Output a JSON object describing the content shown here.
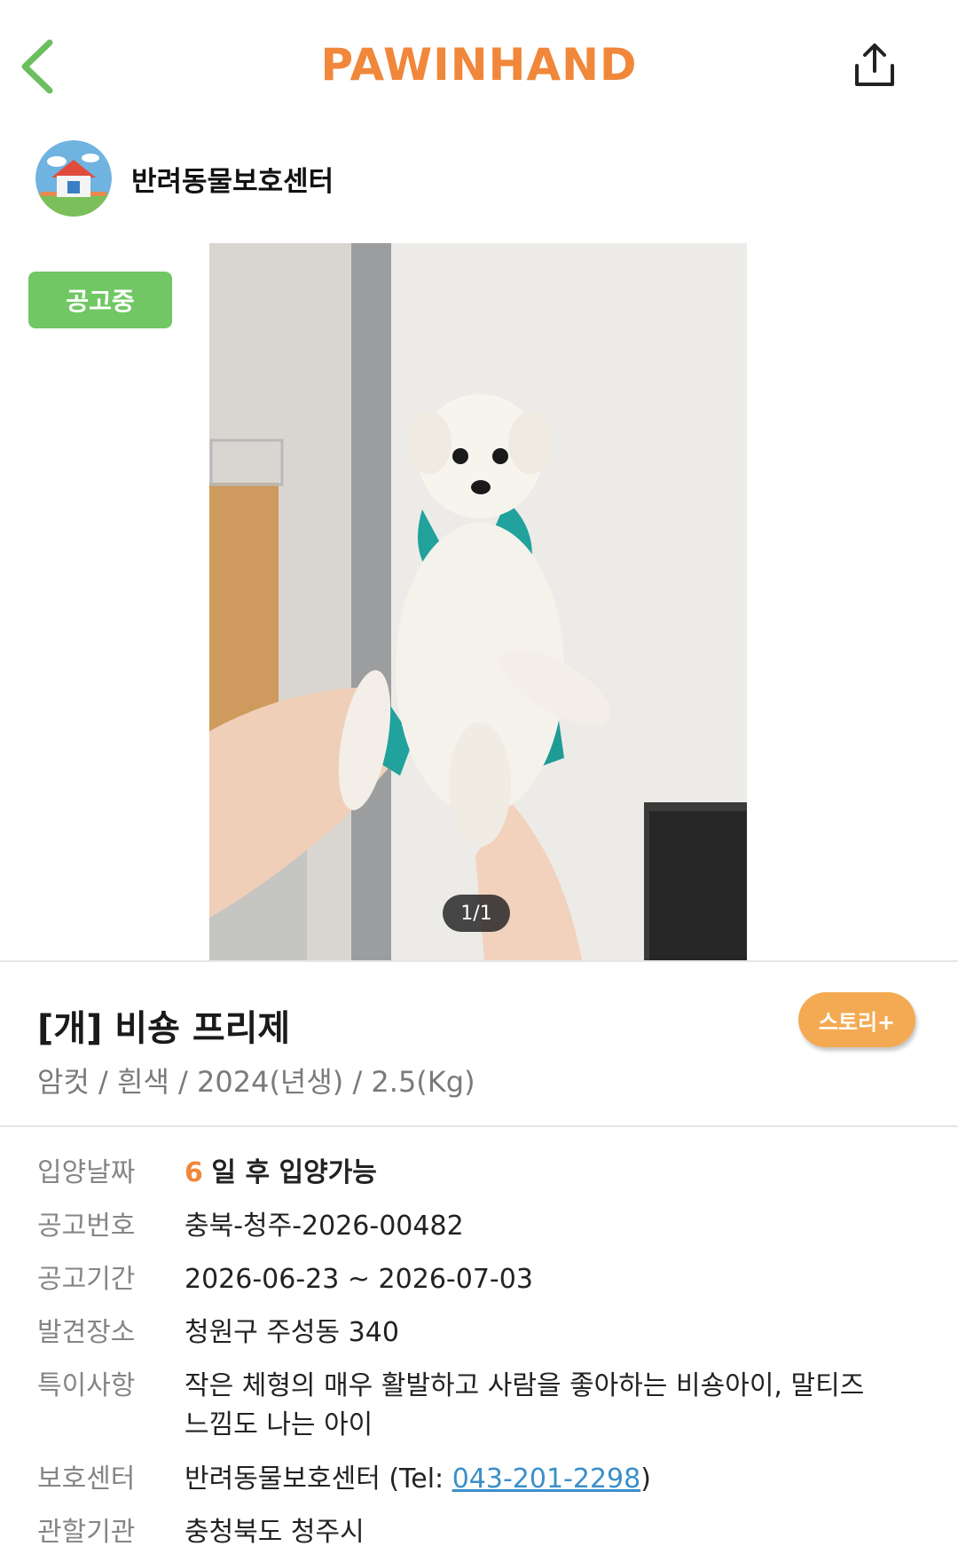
{
  "header": {
    "logo": "PAWINHAND",
    "back_icon": "chevron-left-icon",
    "share_icon": "share-icon"
  },
  "colors": {
    "brand_orange": "#f0873a",
    "status_green": "#70c763",
    "story_orange": "#f4aa52",
    "back_green": "#6bbf5e",
    "link_blue": "#3a8fc9"
  },
  "shelter": {
    "name": "반려동물보호센터"
  },
  "status_badge": "공고중",
  "photo": {
    "counter": "1/1"
  },
  "pet": {
    "title": "[개] 비숑 프리제",
    "subtitle": "암컷 / 흰색 / 2024(년생) / 2.5(Kg)",
    "story_button": "스토리+"
  },
  "details": {
    "adoption_date": {
      "label": "입양날짜",
      "days": "6",
      "text": "일 후 입양가능"
    },
    "notice_no": {
      "label": "공고번호",
      "value": "충북-청주-2026-00482"
    },
    "notice_period": {
      "label": "공고기간",
      "value": "2026-06-23 ~ 2026-07-03"
    },
    "found_place": {
      "label": "발견장소",
      "value": "청원구 주성동 340"
    },
    "notes": {
      "label": "특이사항",
      "value": "작은 체형의 매우 활발하고 사람을 좋아하는 비숑아이, 말티즈 느낌도 나는 아이"
    },
    "shelter": {
      "label": "보호센터",
      "name": "반려동물보호센터 (Tel: ",
      "phone": "043-201-2298",
      "suffix": ")"
    },
    "authority": {
      "label": "관할기관",
      "value": "충청북도 청주시"
    }
  }
}
